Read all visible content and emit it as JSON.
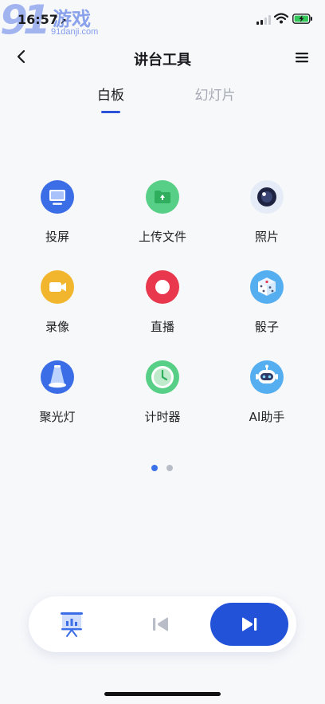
{
  "status_bar": {
    "time": "16:57",
    "location_glyph": "➚",
    "watermark_logo": "91",
    "watermark_name": "游戏",
    "watermark_url": "91danji.com"
  },
  "nav": {
    "title": "讲台工具",
    "back_icon": "chevron-left-icon",
    "menu_icon": "hamburger-menu-icon"
  },
  "tabs": [
    {
      "label": "白板",
      "active": true
    },
    {
      "label": "幻灯片",
      "active": false
    }
  ],
  "tools": [
    {
      "label": "投屏",
      "icon": "monitor-icon",
      "color": "#3b6ee6"
    },
    {
      "label": "上传文件",
      "icon": "folder-upload-icon",
      "color": "#34c56d"
    },
    {
      "label": "照片",
      "icon": "camera-lens-icon",
      "color": "#1d2340"
    },
    {
      "label": "录像",
      "icon": "video-camera-icon",
      "color": "#f2b62e"
    },
    {
      "label": "直播",
      "icon": "live-record-icon",
      "color": "#e9374d"
    },
    {
      "label": "骰子",
      "icon": "dice-icon",
      "color": "#4aa3ea"
    },
    {
      "label": "聚光灯",
      "icon": "spotlight-icon",
      "color": "#3b6ee6"
    },
    {
      "label": "计时器",
      "icon": "clock-timer-icon",
      "color": "#34c56d"
    },
    {
      "label": "AI助手",
      "icon": "robot-icon",
      "color": "#4aa3ea"
    }
  ],
  "pager": {
    "current": 1,
    "total": 2
  },
  "bottom_bar": {
    "present_icon": "presentation-icon",
    "prev_icon": "skip-previous-icon",
    "next_icon": "skip-next-icon",
    "accent": "#2252d8"
  }
}
